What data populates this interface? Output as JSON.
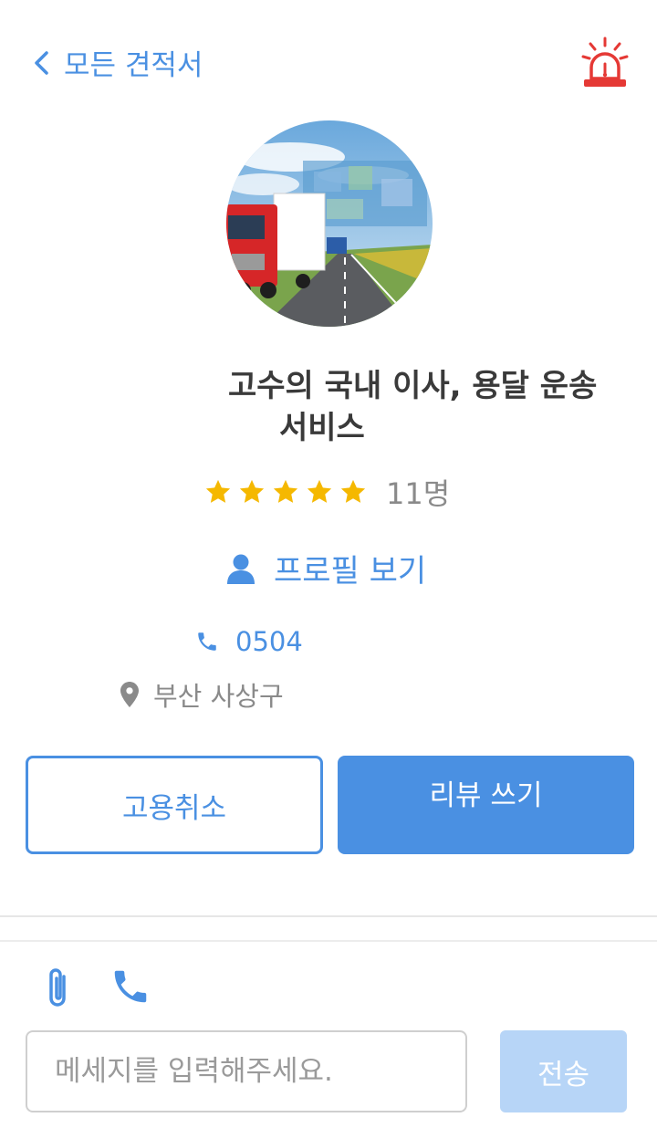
{
  "header": {
    "back_label": "모든 견적서",
    "back_icon": "chevron-left-icon",
    "alarm_icon": "siren-icon"
  },
  "provider": {
    "title_line1": "고수의 국내 이사, 용달 운송",
    "title_line2": "서비스",
    "rating_stars": 5,
    "review_count": "11명",
    "profile_link_label": "프로필 보기",
    "phone": "0504",
    "location": "부산 사상구"
  },
  "actions": {
    "cancel_hire_label": "고용취소",
    "write_review_label": "리뷰 쓰기"
  },
  "composer": {
    "placeholder": "메세지를 입력해주세요.",
    "send_label": "전송"
  },
  "colors": {
    "accent": "#4a90e2",
    "star": "#f5b800",
    "alarm": "#e53935",
    "send_disabled": "#b7d5f7"
  }
}
